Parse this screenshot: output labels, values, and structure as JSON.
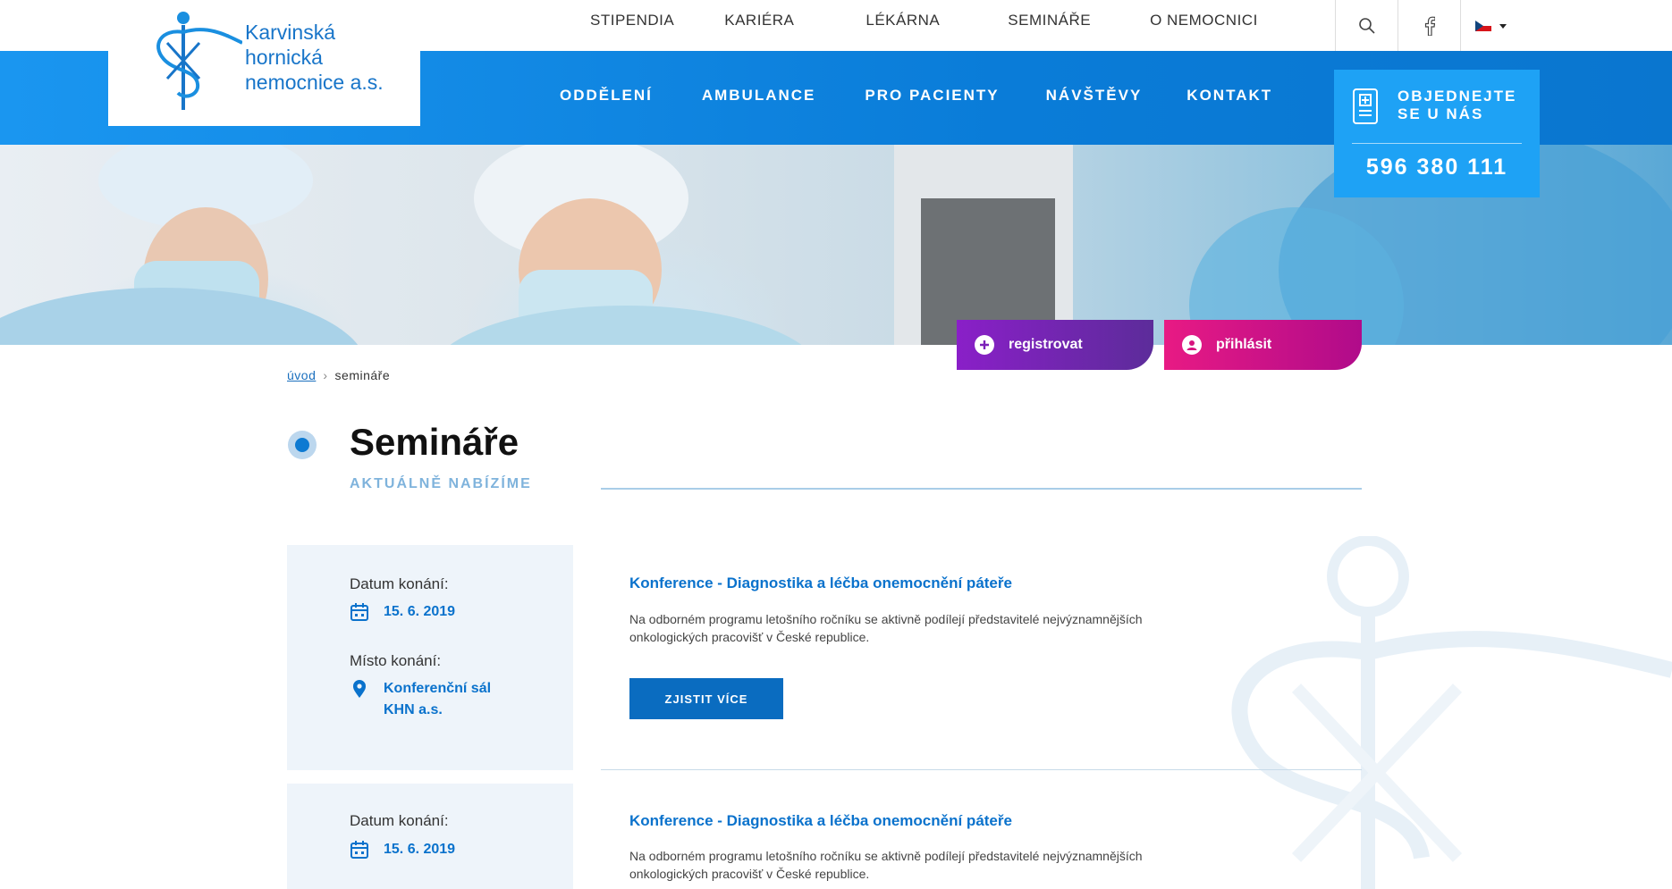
{
  "logo": {
    "line1": "Karvinská",
    "line2": "hornická",
    "line3": "nemocnice a.s."
  },
  "topnav": [
    "STIPENDIA",
    "KARIÉRA",
    "LÉKÁRNA",
    "SEMINÁŘE",
    "O NEMOCNICI"
  ],
  "mainnav": [
    "ODDĚLENÍ",
    "AMBULANCE",
    "PRO PACIENTY",
    "NÁVŠTĚVY",
    "KONTAKT"
  ],
  "order": {
    "line1": "OBJEDNEJTE",
    "line2": "SE U NÁS",
    "phone": "596 380 111"
  },
  "actions": {
    "register": "registrovat",
    "login": "přihlásit"
  },
  "breadcrumb": {
    "home": "úvod",
    "sep": "›",
    "current": "semináře"
  },
  "page": {
    "title": "Semináře",
    "subtitle": "AKTUÁLNĚ NABÍZÍME"
  },
  "events": [
    {
      "date_label": "Datum konání:",
      "date": "15. 6. 2019",
      "place_label": "Místo konání:",
      "place_line1": "Konferenční sál",
      "place_line2": "KHN a.s.",
      "title": "Konference - Diagnostika a léčba onemocnění páteře",
      "desc_line1": "Na odborném programu letošního ročníku se aktivně podílejí představitelé nejvýznamnějších",
      "desc_line2": "onkologických pracovišť v České republice.",
      "button": "ZJISTIT VÍCE"
    },
    {
      "date_label": "Datum konání:",
      "date": "15. 6. 2019",
      "title": "Konference - Diagnostika a léčba onemocnění páteře",
      "desc_line1": "Na odborném programu letošního ročníku se aktivně podílejí představitelé nejvýznamnějších",
      "desc_line2": "onkologických pracovišť v České republice."
    }
  ]
}
